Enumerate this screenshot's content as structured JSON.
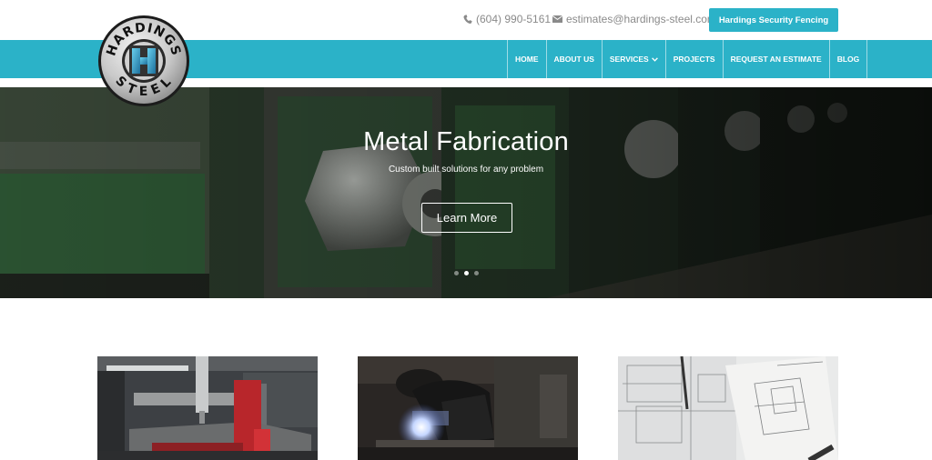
{
  "header": {
    "phone": "(604) 990-5161",
    "email": "estimates@hardings-steel.com",
    "cta_label": "Hardings Security Fencing"
  },
  "logo": {
    "top_text": "HARDINGS",
    "bottom_text": "STEEL"
  },
  "nav": {
    "items": [
      {
        "label": "HOME"
      },
      {
        "label": "ABOUT US"
      },
      {
        "label": "SERVICES"
      },
      {
        "label": "PROJECTS"
      },
      {
        "label": "REQUEST AN ESTIMATE"
      },
      {
        "label": "BLOG"
      }
    ]
  },
  "hero": {
    "title": "Metal Fabrication",
    "subtitle": "Custom built solutions for any problem",
    "button_label": "Learn More",
    "active_slide": 2,
    "slide_count": 3
  },
  "icons": {
    "phone": "phone-icon",
    "email": "envelope-icon",
    "dropdown": "chevron-down-icon"
  },
  "colors": {
    "accent": "#2bb2c8",
    "text_muted": "#8a8a8a"
  }
}
